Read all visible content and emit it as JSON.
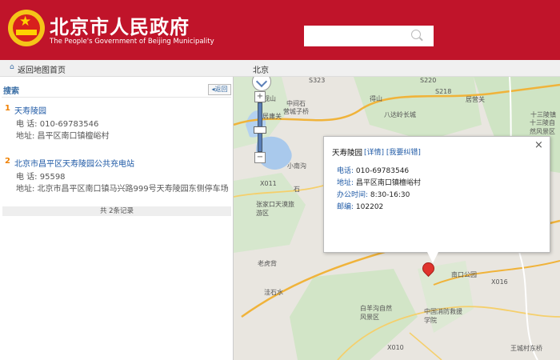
{
  "header": {
    "title": "北京市人民政府",
    "subtitle": "The People's Government of Beijing Municipality",
    "search_placeholder": ""
  },
  "topbar": {
    "back_home": "返回地图首页",
    "city": "北京"
  },
  "sidebar": {
    "search_label": "搜索",
    "back_button": "返回",
    "results": [
      {
        "num": "1",
        "name": "天寿陵园",
        "phone": "电  话:  010-69783546",
        "address": "地址:  昌平区南口镇檀峪村"
      },
      {
        "num": "2",
        "name": "北京市昌平区天寿陵园公共充电站",
        "phone": "电  话:  95598",
        "address": "地址:  北京市昌平区南口镇马兴路999号天寿陵园东侧停车场"
      }
    ],
    "count_text": "共 2条记录"
  },
  "map": {
    "labels": [
      "观山",
      "中间石",
      "居庸关",
      "营城子桥",
      "得山",
      "八达岭长城",
      "S218",
      "居营关",
      "十三陵镇",
      "十三陵自然风景区",
      "石",
      "S220",
      "S323",
      "小南沟",
      "X011",
      "张家口天漠旅游区",
      "老虎背",
      "X016",
      "南口公园",
      "洼石水",
      "白羊沟自然风景区",
      "中国消防救援学院",
      "王城村东桥",
      "X010"
    ],
    "popup": {
      "title": "天寿陵园",
      "links": "[详情] [我要纠错]",
      "close": "×",
      "phone_label": "电话:",
      "phone": "010-69783546",
      "address_label": "地址:",
      "address": "昌平区南口镇檀峪村",
      "hours_label": "办公时间:",
      "hours": "8:30-16:30",
      "postcode_label": "邮编:",
      "postcode": "102202"
    }
  },
  "colors": {
    "header_red": "#c0142a",
    "link_blue": "#1f5aa6",
    "number_orange": "#f08000"
  }
}
